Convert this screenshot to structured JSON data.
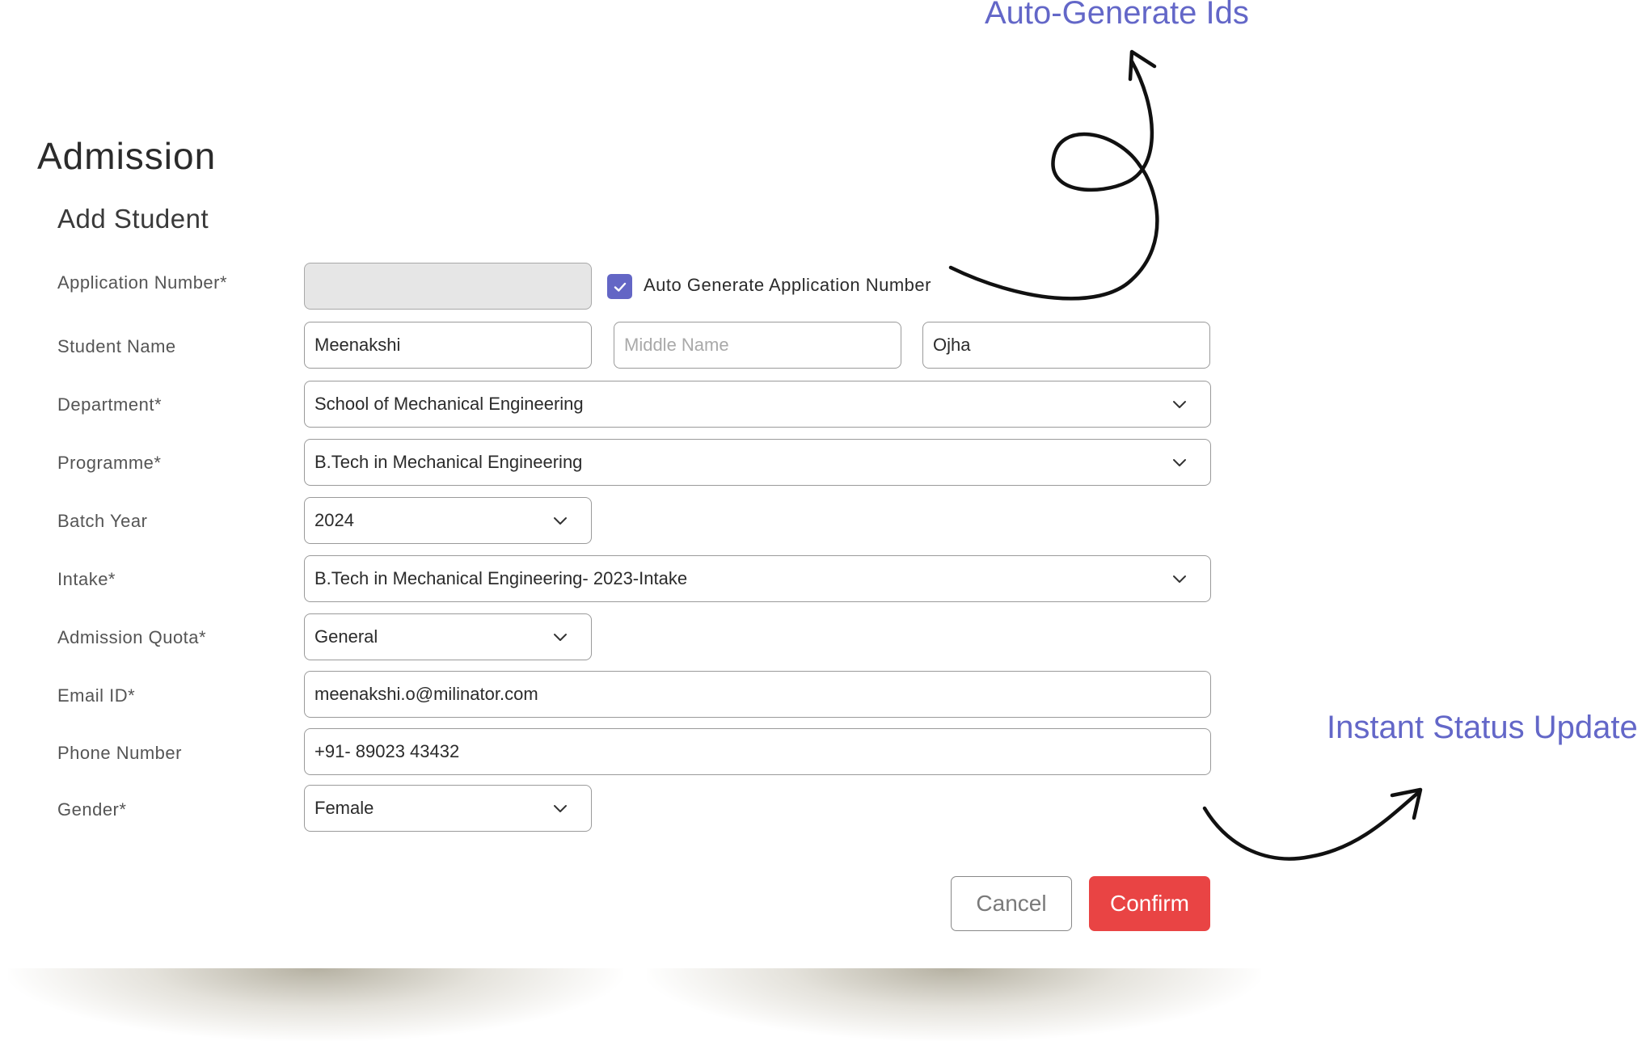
{
  "page": {
    "title": "Admission",
    "section": "Add Student"
  },
  "form": {
    "application_number": {
      "label": "Application Number*",
      "value": ""
    },
    "auto_generate": {
      "label": "Auto Generate Application Number",
      "checked": true
    },
    "student_name": {
      "label": "Student Name",
      "first": "Meenakshi",
      "middle_placeholder": "Middle Name",
      "last": "Ojha"
    },
    "department": {
      "label": "Department*",
      "value": "School of Mechanical Engineering"
    },
    "programme": {
      "label": "Programme*",
      "value": "B.Tech in Mechanical Engineering"
    },
    "batch_year": {
      "label": "Batch Year",
      "value": "2024"
    },
    "intake": {
      "label": "Intake*",
      "value": "B.Tech in Mechanical Engineering- 2023-Intake"
    },
    "admission_quota": {
      "label": "Admission Quota*",
      "value": "General"
    },
    "email": {
      "label": "Email ID*",
      "value": "meenakshi.o@milinator.com"
    },
    "phone": {
      "label": "Phone Number",
      "value": "+91- 89023 43432"
    },
    "gender": {
      "label": "Gender*",
      "value": "Female"
    }
  },
  "actions": {
    "cancel": "Cancel",
    "confirm": "Confirm"
  },
  "annotations": {
    "top": "Auto-Generate Ids",
    "bottom": "Instant Status Update"
  },
  "colors": {
    "accent": "#6366c5",
    "confirm": "#e94444",
    "annotation": "#6367c8"
  },
  "icons": [
    "check-icon",
    "chevron-down-icon",
    "arrow-icon"
  ]
}
